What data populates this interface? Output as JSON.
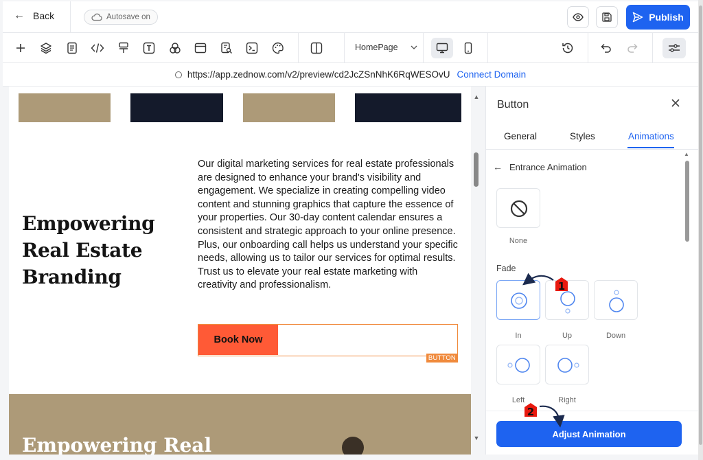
{
  "topbar": {
    "back_label": "Back",
    "autosave_label": "Autosave on",
    "publish_label": "Publish"
  },
  "toolbar": {
    "page_select": "HomePage"
  },
  "urlbar": {
    "url": "https://app.zednow.com/v2/preview/cd2JcZSnNhK6RqWESOvU",
    "connect_label": "Connect Domain"
  },
  "canvas": {
    "headline": [
      "Empowering",
      "Real Estate",
      "Branding"
    ],
    "paragraph": "Our digital marketing services for real estate professionals are designed to enhance your brand's visibility and engagement. We specialize in creating compelling video content and stunning graphics that capture the essence of your properties. Our 30-day content calendar ensures a consistent and strategic approach to your online presence. Plus, our onboarding call helps us understand your specific needs, allowing us to tailor our services for optimal results. Trust us to elevate your real estate marketing with creativity and professionalism.",
    "cta_label": "Book Now",
    "element_tag": "BUTTON",
    "next_section_heading": "Empowering Real"
  },
  "panel": {
    "title": "Button",
    "tabs": [
      "General",
      "Styles",
      "Animations"
    ],
    "active_tab": "Animations",
    "subheading": "Entrance Animation",
    "none_label": "None",
    "group_label": "Fade",
    "options": [
      "In",
      "Up",
      "Down",
      "Left",
      "Right"
    ],
    "selected_option": "In",
    "adjust_label": "Adjust Animation"
  },
  "annotations": [
    "1",
    "2"
  ],
  "colors": {
    "accent": "#1e63f0",
    "cta": "#ff5a36",
    "selection_outline": "#f08a3c",
    "tan": "#ad9a78",
    "navy": "#141a2b",
    "marker": "#e8190f"
  }
}
